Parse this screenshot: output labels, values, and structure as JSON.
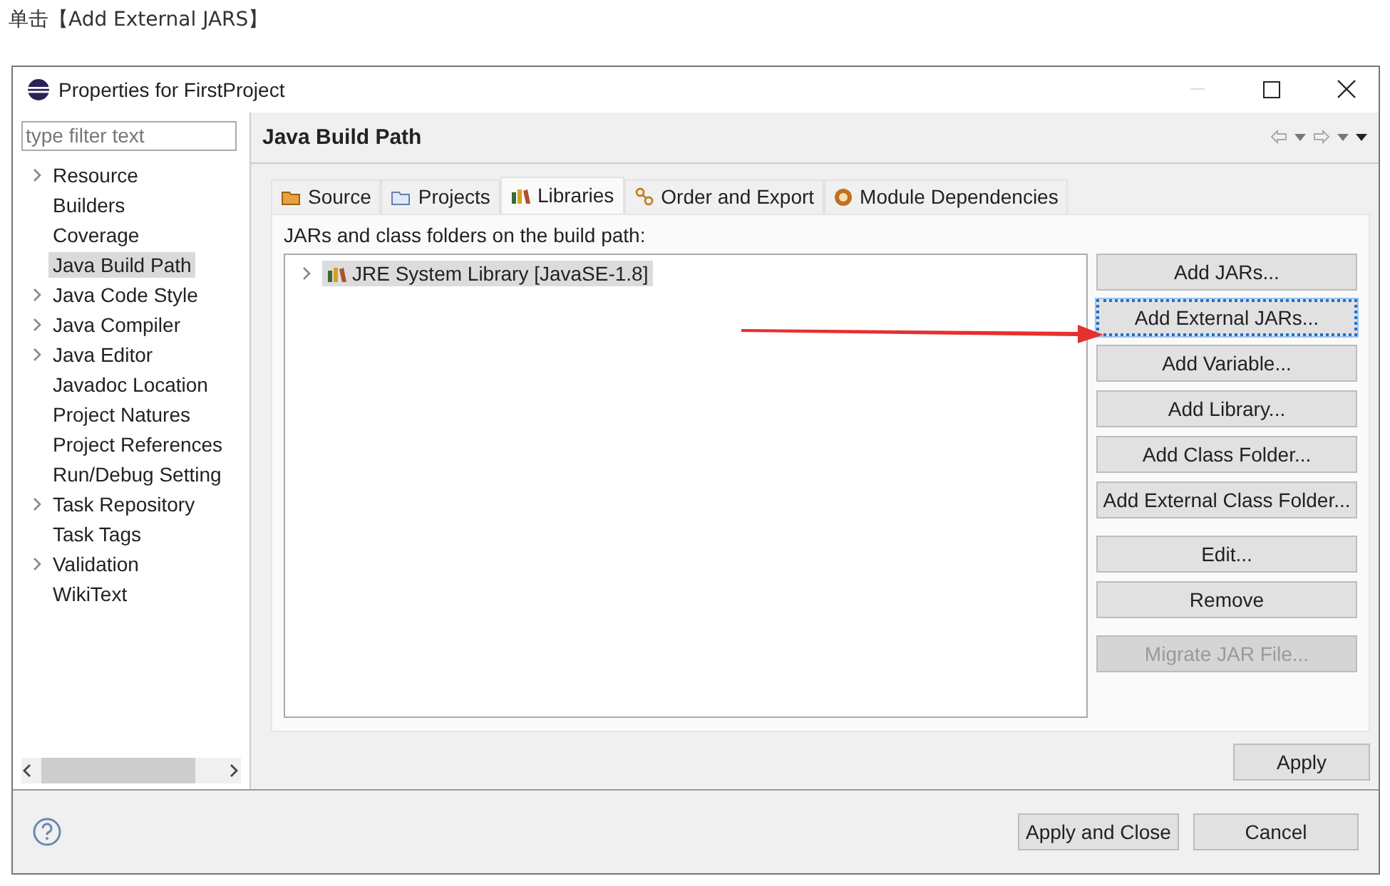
{
  "caption": "单击【Add External JARS】",
  "window": {
    "title": "Properties for FirstProject"
  },
  "sidebar": {
    "filter": {
      "placeholder": "type filter text"
    },
    "items": [
      {
        "label": "Resource",
        "expandable": true,
        "selected": false
      },
      {
        "label": "Builders",
        "expandable": false,
        "selected": false
      },
      {
        "label": "Coverage",
        "expandable": false,
        "selected": false
      },
      {
        "label": "Java Build Path",
        "expandable": false,
        "selected": true
      },
      {
        "label": "Java Code Style",
        "expandable": true,
        "selected": false
      },
      {
        "label": "Java Compiler",
        "expandable": true,
        "selected": false
      },
      {
        "label": "Java Editor",
        "expandable": true,
        "selected": false
      },
      {
        "label": "Javadoc Location",
        "expandable": false,
        "selected": false
      },
      {
        "label": "Project Natures",
        "expandable": false,
        "selected": false
      },
      {
        "label": "Project References",
        "expandable": false,
        "selected": false
      },
      {
        "label": "Run/Debug Setting",
        "expandable": false,
        "selected": false
      },
      {
        "label": "Task Repository",
        "expandable": true,
        "selected": false
      },
      {
        "label": "Task Tags",
        "expandable": false,
        "selected": false
      },
      {
        "label": "Validation",
        "expandable": true,
        "selected": false
      },
      {
        "label": "WikiText",
        "expandable": false,
        "selected": false
      }
    ]
  },
  "page": {
    "title": "Java Build Path",
    "tabs": [
      {
        "label": "Source",
        "kind": "source",
        "selected": false
      },
      {
        "label": "Projects",
        "kind": "projects",
        "selected": false
      },
      {
        "label": "Libraries",
        "kind": "libraries",
        "selected": true
      },
      {
        "label": "Order and Export",
        "kind": "order",
        "selected": false
      },
      {
        "label": "Module Dependencies",
        "kind": "module",
        "selected": false
      }
    ],
    "list_label": "JARs and class folders on the build path:",
    "entries": [
      {
        "label": "JRE System Library [JavaSE-1.8]",
        "expandable": true,
        "selected": true
      }
    ],
    "button_groups": [
      [
        {
          "label": "Add JARs...",
          "focused": false,
          "disabled": false
        },
        {
          "label": "Add External JARs...",
          "focused": true,
          "disabled": false
        },
        {
          "label": "Add Variable...",
          "focused": false,
          "disabled": false
        },
        {
          "label": "Add Library...",
          "focused": false,
          "disabled": false
        },
        {
          "label": "Add Class Folder...",
          "focused": false,
          "disabled": false
        },
        {
          "label": "Add External Class Folder...",
          "focused": false,
          "disabled": false
        }
      ],
      [
        {
          "label": "Edit...",
          "focused": false,
          "disabled": false
        },
        {
          "label": "Remove",
          "focused": false,
          "disabled": false
        }
      ],
      [
        {
          "label": "Migrate JAR File...",
          "focused": false,
          "disabled": true
        }
      ]
    ],
    "apply": "Apply"
  },
  "footer": {
    "buttons": [
      "Apply and Close",
      "Cancel"
    ]
  }
}
